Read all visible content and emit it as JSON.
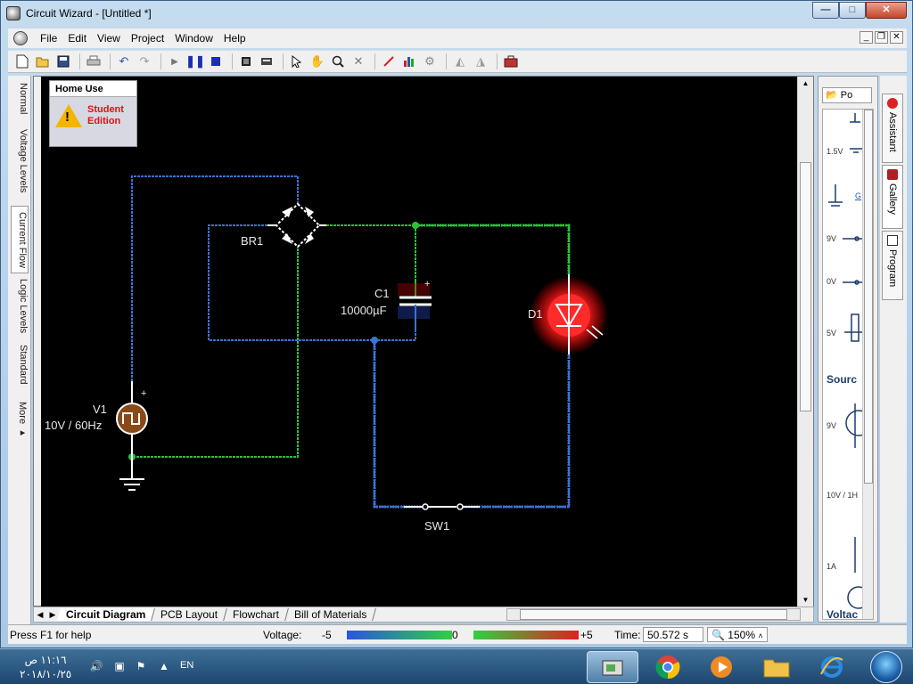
{
  "window": {
    "title": "Circuit Wizard - [Untitled *]",
    "controls": {
      "minimize": "—",
      "maximize": "□",
      "close": "✕"
    }
  },
  "menubar": {
    "items": [
      "File",
      "Edit",
      "View",
      "Project",
      "Window",
      "Help"
    ],
    "mdi": {
      "minimize": "_",
      "restore": "❐",
      "close": "✕"
    }
  },
  "toolbar": {
    "icons": [
      "new-icon",
      "open-icon",
      "save-icon",
      "print-icon",
      "undo-icon",
      "redo-icon",
      "step-icon",
      "play-icon",
      "pause-icon",
      "stop-icon",
      "component-icon",
      "component-menu-icon",
      "select-icon",
      "pan-icon",
      "zoom-icon",
      "delete-icon",
      "probe-icon",
      "graph-icon",
      "analyze-icon",
      "rotate-left-icon",
      "rotate-right-icon",
      "toolbox-icon"
    ]
  },
  "left_tabs": {
    "items": [
      "Normal",
      "Voltage Levels",
      "Current Flow",
      "Logic Levels",
      "Standard",
      "More ▸"
    ],
    "active": "Current Flow"
  },
  "badge": {
    "title": "Home Use",
    "line1": "Student",
    "line2": "Edition"
  },
  "circuit": {
    "br1": "BR1",
    "c1_name": "C1",
    "c1_value": "10000µF",
    "d1": "D1",
    "v1_name": "V1",
    "v1_value": "10V / 60Hz",
    "sw1": "SW1",
    "plus": "+",
    "colors": {
      "high": "#27c43a",
      "low": "#3b73d4",
      "led": "#ff2a2a"
    }
  },
  "bottom_tabs": {
    "items": [
      "Circuit Diagram",
      "PCB Layout",
      "Flowchart",
      "Bill of Materials"
    ],
    "active": "Circuit Diagram"
  },
  "statusbar": {
    "help": "Press F1 for help",
    "voltage_label": "Voltage:",
    "v_min": "-5",
    "v_mid": "0",
    "v_max": "+5",
    "time_label": "Time:",
    "time_value": "50.572 s",
    "zoom_value": "150%"
  },
  "right_panel": {
    "combo": "Po",
    "labels": [
      "1.5V",
      "G",
      "9V",
      "0V",
      "5V",
      "9V",
      "10V / 1H",
      "1A"
    ],
    "headings": [
      "Sourc",
      "Voltac"
    ]
  },
  "side_tabs": [
    "Assistant",
    "Gallery",
    "Program"
  ],
  "taskbar": {
    "time": "١١:١٦ ص",
    "date": "٢٠١٨/١٠/٢٥",
    "lang": "EN"
  }
}
